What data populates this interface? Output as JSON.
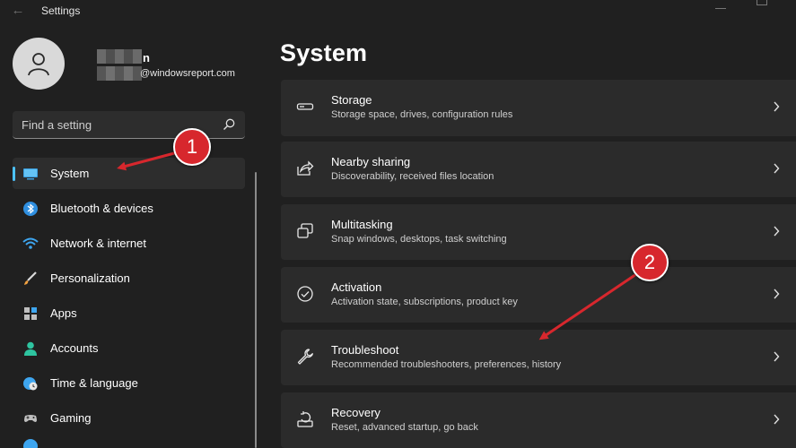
{
  "window": {
    "title": "Settings"
  },
  "user": {
    "name_suffix": "n",
    "email_suffix": "@windowsreport.com"
  },
  "search": {
    "placeholder": "Find a setting"
  },
  "sidebar": {
    "items": [
      {
        "label": "System",
        "icon": "display-icon",
        "selected": true
      },
      {
        "label": "Bluetooth & devices",
        "icon": "bluetooth-icon"
      },
      {
        "label": "Network & internet",
        "icon": "wifi-icon"
      },
      {
        "label": "Personalization",
        "icon": "brush-icon"
      },
      {
        "label": "Apps",
        "icon": "apps-icon"
      },
      {
        "label": "Accounts",
        "icon": "person-icon"
      },
      {
        "label": "Time & language",
        "icon": "globe-clock-icon"
      },
      {
        "label": "Gaming",
        "icon": "gamepad-icon"
      }
    ]
  },
  "main": {
    "title": "System",
    "cards": [
      {
        "title": "Storage",
        "description": "Storage space, drives, configuration rules",
        "icon": "storage-icon"
      },
      {
        "title": "Nearby sharing",
        "description": "Discoverability, received files location",
        "icon": "share-icon"
      },
      {
        "title": "Multitasking",
        "description": "Snap windows, desktops, task switching",
        "icon": "multitasking-icon"
      },
      {
        "title": "Activation",
        "description": "Activation state, subscriptions, product key",
        "icon": "check-circle-icon"
      },
      {
        "title": "Troubleshoot",
        "description": "Recommended troubleshooters, preferences, history",
        "icon": "wrench-icon"
      },
      {
        "title": "Recovery",
        "description": "Reset, advanced startup, go back",
        "icon": "recovery-icon"
      }
    ]
  },
  "annotations": [
    {
      "label": "1"
    },
    {
      "label": "2"
    }
  ],
  "colors": {
    "accent": "#4cc2ff",
    "background": "#202020",
    "card": "#2b2b2b",
    "annotation_red": "#d7272d"
  }
}
